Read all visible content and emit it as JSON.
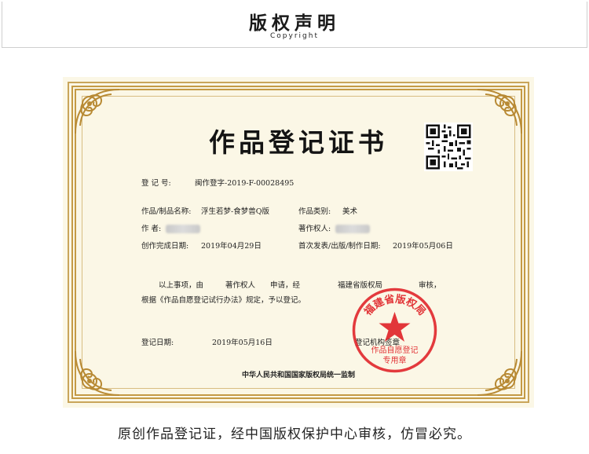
{
  "header": {
    "title": "版权声明",
    "subtitle": "Copyright"
  },
  "certificate": {
    "title": "作品登记证书",
    "reg_no_label": "登  记  号:",
    "reg_no_value": "闽作登字-2019-F-00028495",
    "work_name_label": "作品/制品名称:",
    "work_name_value": "浮生若梦-食梦兽Q版",
    "category_label": "作品类别:",
    "category_value": "美术",
    "author_label": "作        者:",
    "author_value_blurred": "",
    "owner_label": "著作权人:",
    "owner_value_blurred": "",
    "completion_label": "创作完成日期:",
    "completion_value": "2019年04月29日",
    "publish_label": "首次发表/出版/制作日期:",
    "publish_value": "2019年05月06日",
    "body_line1_a": "以上事项，由",
    "body_line1_b": "著作权人",
    "body_line1_c": "申请，经",
    "body_line1_d": "福建省版权局",
    "body_line1_e": "审核，",
    "body_line2": "根据《作品自愿登记试行办法》规定，予以登记。",
    "reg_date_label": "登记日期:",
    "reg_date_value": "2019年05月16日",
    "reg_authority_label": "登记机构签章",
    "footer": "中华人民共和国国家版权局统一监制",
    "seal_top_text": "福建省版权局",
    "seal_line1": "作品自愿登记",
    "seal_line2": "专用章"
  },
  "footer_note": "原创作品登记证，经中国版权保护中心审核，仿冒必究。",
  "colors": {
    "paper": "#fbf7e6",
    "gold": "#c49a45",
    "seal_red": "#e0252a"
  }
}
